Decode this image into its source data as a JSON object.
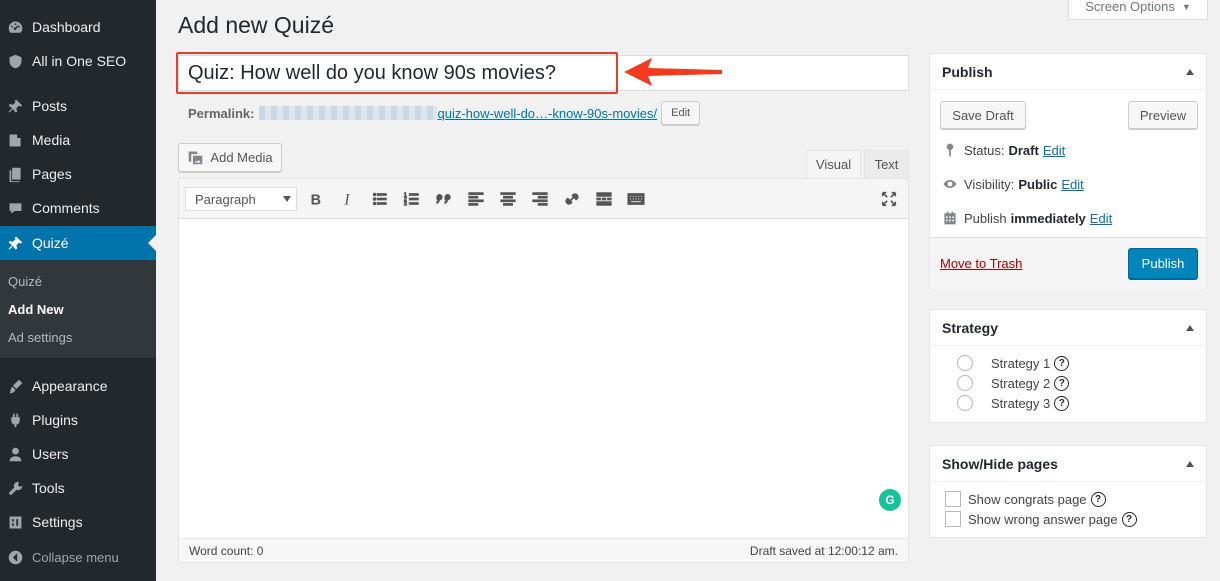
{
  "sidebar": {
    "items": [
      {
        "label": "Dashboard",
        "icon": "dashboard-icon"
      },
      {
        "label": "All in One SEO",
        "icon": "shield-icon"
      },
      {
        "label": "Posts",
        "icon": "pushpin-icon"
      },
      {
        "label": "Media",
        "icon": "media-icon"
      },
      {
        "label": "Pages",
        "icon": "pages-icon"
      },
      {
        "label": "Comments",
        "icon": "comment-icon"
      },
      {
        "label": "Quizé",
        "icon": "pushpin-icon",
        "active": true
      },
      {
        "label": "Appearance",
        "icon": "paintbrush-icon"
      },
      {
        "label": "Plugins",
        "icon": "plugin-icon"
      },
      {
        "label": "Users",
        "icon": "user-icon"
      },
      {
        "label": "Tools",
        "icon": "wrench-icon"
      },
      {
        "label": "Settings",
        "icon": "settings-icon"
      },
      {
        "label": "Collapse menu",
        "icon": "collapse-icon"
      }
    ],
    "submenu": [
      "Quizé",
      "Add New",
      "Ad settings"
    ],
    "current_submenu": "Add New"
  },
  "header": {
    "title": "Add new Quizé",
    "screen_options": "Screen Options"
  },
  "post": {
    "title": "Quiz: How well do you know 90s movies?",
    "permalink_label": "Permalink:",
    "permalink_slug": "quiz-how-well-do…-know-90s-movies/",
    "permalink_edit": "Edit"
  },
  "editor": {
    "add_media": "Add Media",
    "tab_visual": "Visual",
    "tab_text": "Text",
    "format": "Paragraph",
    "word_count": "Word count: 0",
    "draft_saved": "Draft saved at 12:00:12 am."
  },
  "publish_box": {
    "title": "Publish",
    "save_draft": "Save Draft",
    "preview": "Preview",
    "status_label": "Status:",
    "status_value": "Draft",
    "visibility_label": "Visibility:",
    "visibility_value": "Public",
    "publish_label": "Publish",
    "publish_value": "immediately",
    "edit": "Edit",
    "move_to_trash": "Move to Trash",
    "publish_button": "Publish"
  },
  "strategy_box": {
    "title": "Strategy",
    "options": [
      "Strategy 1",
      "Strategy 2",
      "Strategy 3"
    ],
    "help": "?"
  },
  "showhide_box": {
    "title": "Show/Hide pages",
    "options": [
      "Show congrats page",
      "Show wrong answer page"
    ],
    "help": "?"
  },
  "colors": {
    "accent": "#0073aa",
    "sidebar_bg": "#23282d",
    "publish_button": "#0085ba",
    "annotation": "#e43f2b"
  }
}
